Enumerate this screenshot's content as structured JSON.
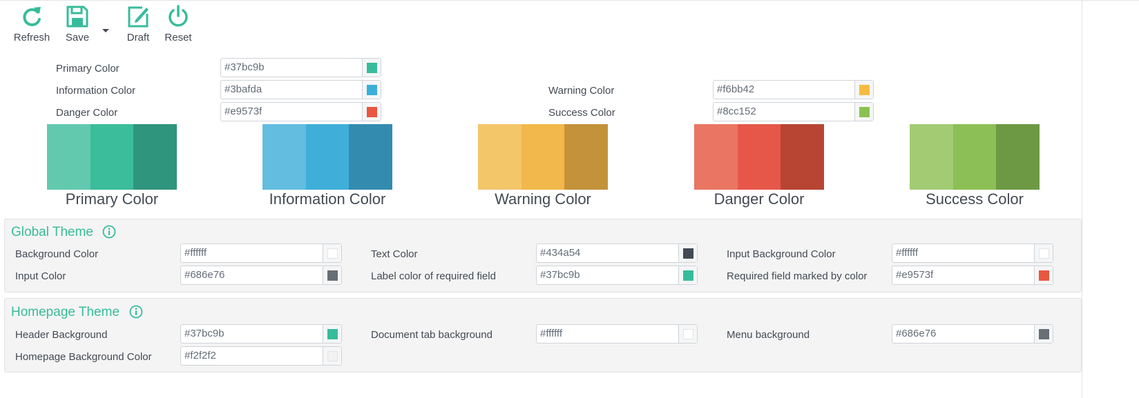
{
  "toolbar": {
    "refresh_label": "Refresh",
    "save_label": "Save",
    "draft_label": "Draft",
    "reset_label": "Reset",
    "icon_color": "#37bc9b"
  },
  "main_colors": {
    "primary": {
      "label": "Primary Color",
      "value": "#37bc9b"
    },
    "information": {
      "label": "Information Color",
      "value": "#3bafda"
    },
    "danger": {
      "label": "Danger Color",
      "value": "#e9573f"
    },
    "warning": {
      "label": "Warning Color",
      "value": "#f6bb42"
    },
    "success": {
      "label": "Success Color",
      "value": "#8cc152"
    }
  },
  "palettes": [
    {
      "name": "Primary Color",
      "shades": [
        "#62c9af",
        "#3bbc9b",
        "#2f957c"
      ]
    },
    {
      "name": "Information Color",
      "shades": [
        "#62bde0",
        "#3fafd9",
        "#338cb0"
      ]
    },
    {
      "name": "Warning Color",
      "shades": [
        "#f4c66a",
        "#f2b84b",
        "#c3923a"
      ]
    },
    {
      "name": "Danger Color",
      "shades": [
        "#ea7563",
        "#e6574a",
        "#b84434"
      ]
    },
    {
      "name": "Success Color",
      "shades": [
        "#a3cb74",
        "#8cbf55",
        "#6e9944"
      ]
    }
  ],
  "global_theme": {
    "title": "Global Theme",
    "fields": {
      "background_color": {
        "label": "Background Color",
        "value": "#ffffff"
      },
      "input_color": {
        "label": "Input Color",
        "value": "#686e76"
      },
      "text_color": {
        "label": "Text Color",
        "value": "#434a54"
      },
      "label_required": {
        "label": "Label color of required field",
        "value": "#37bc9b"
      },
      "input_background": {
        "label": "Input Background Color",
        "value": "#ffffff"
      },
      "required_marked": {
        "label": "Required field marked by color",
        "value": "#e9573f"
      }
    }
  },
  "homepage_theme": {
    "title": "Homepage Theme",
    "fields": {
      "header_background": {
        "label": "Header Background",
        "value": "#37bc9b"
      },
      "homepage_background": {
        "label": "Homepage Background Color",
        "value": "#f2f2f2"
      },
      "document_tab_background": {
        "label": "Document tab background",
        "value": "#ffffff"
      },
      "menu_background": {
        "label": "Menu background",
        "value": "#686e76"
      }
    }
  }
}
